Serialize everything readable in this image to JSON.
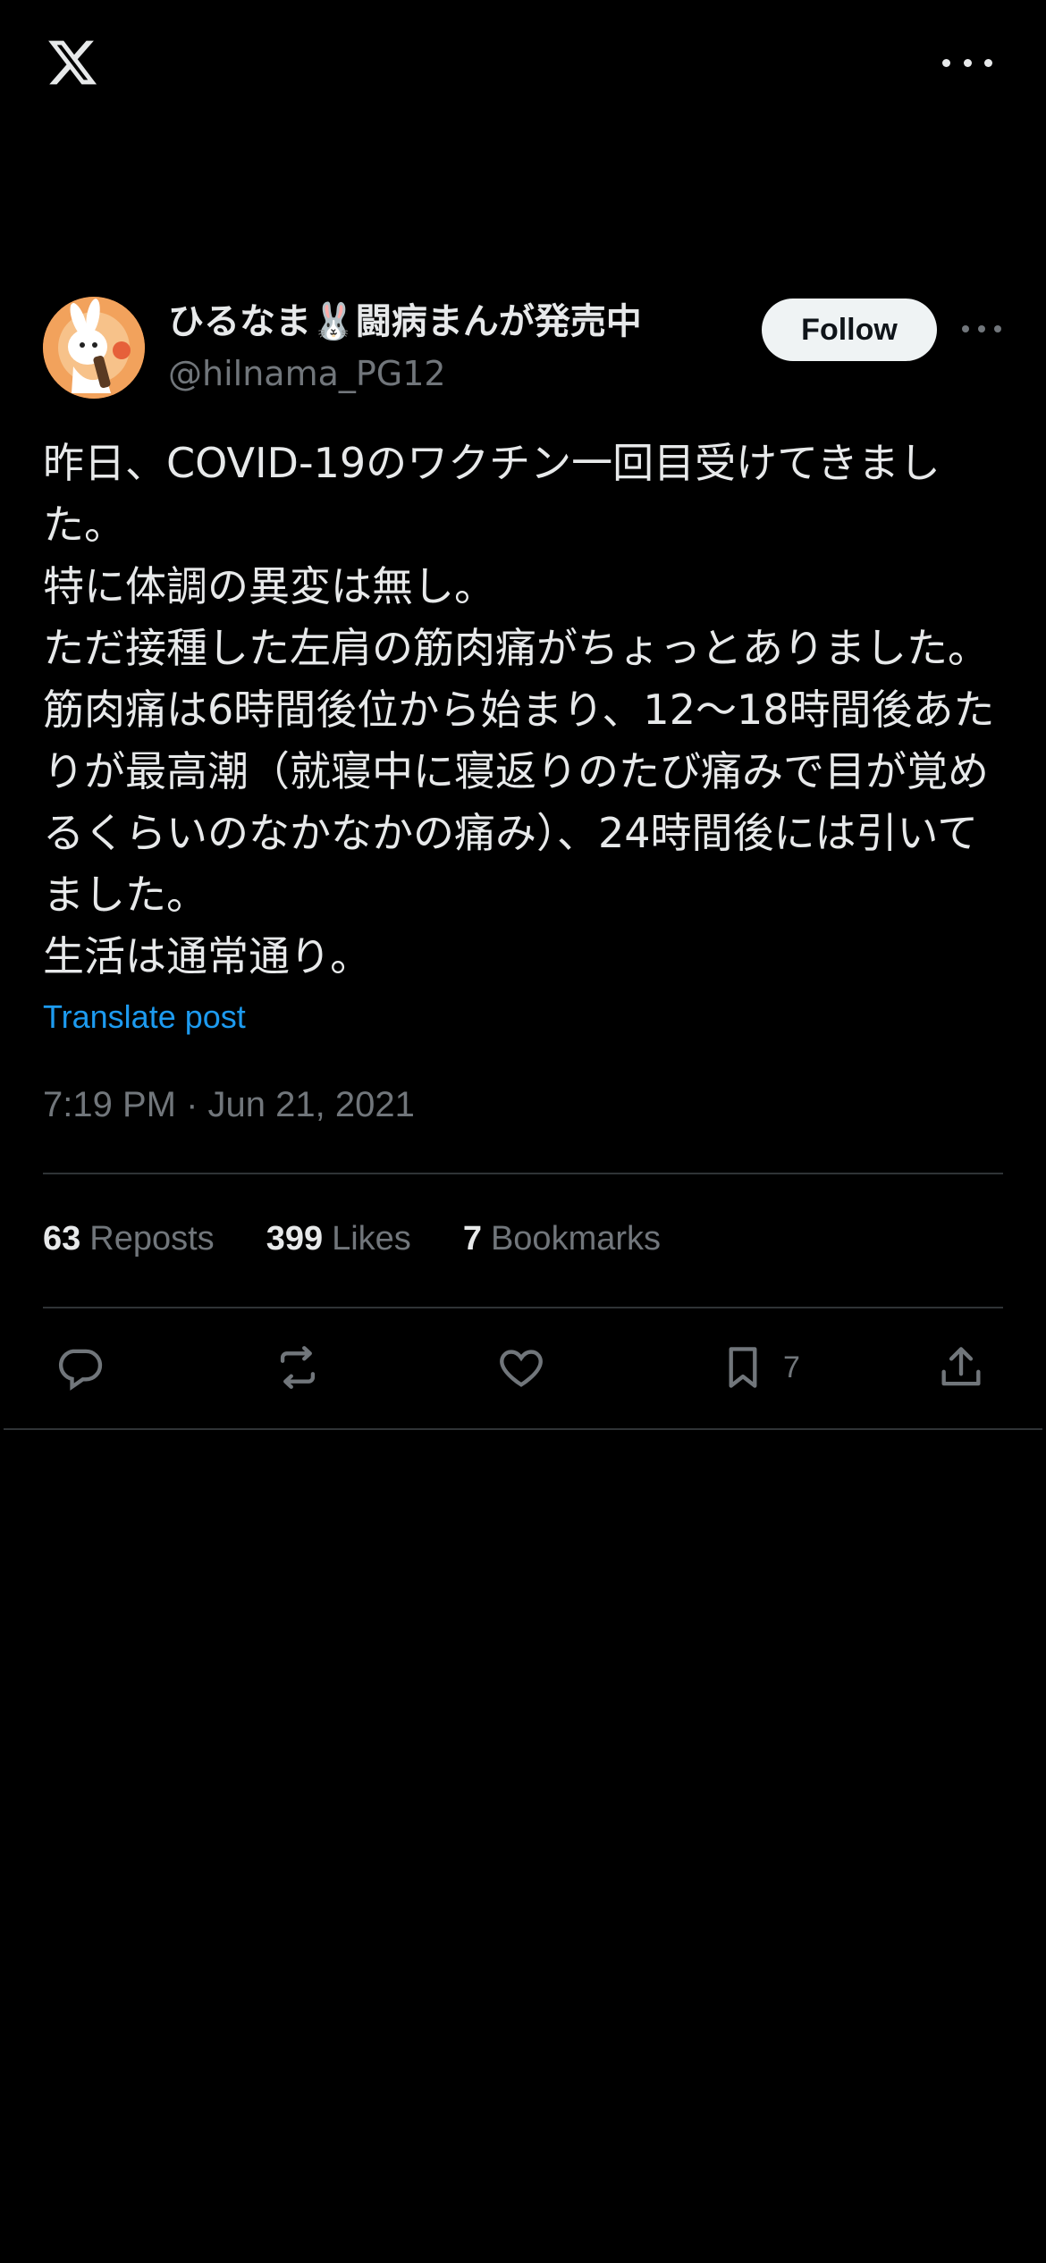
{
  "header": {
    "logo": "x-logo",
    "more_icon": "more-horizontal-icon"
  },
  "author": {
    "display_name": "ひるなま🐰闘病まんが発売中",
    "handle": "@hilnama_PG12",
    "avatar": "rabbit-avatar",
    "follow_label": "Follow"
  },
  "post": {
    "lines": [
      "昨日、COVID-19のワクチン一回目受けてきました。",
      "特に体調の異変は無し。",
      "ただ接種した左肩の筋肉痛がちょっとありました。筋肉痛は6時間後位から始まり、12〜18時間後あたりが最高潮（就寝中に寝返りのたび痛みで目が覚めるくらいのなかなかの痛み）、24時間後には引いてました。",
      "生活は通常通り。"
    ],
    "translate_label": "Translate post",
    "timestamp": "7:19 PM · Jun 21, 2021"
  },
  "stats": {
    "reposts_count": "63",
    "reposts_label": "Reposts",
    "likes_count": "399",
    "likes_label": "Likes",
    "bookmarks_count": "7",
    "bookmarks_label": "Bookmarks"
  },
  "actions": {
    "reply_icon": "reply-icon",
    "repost_icon": "repost-icon",
    "like_icon": "heart-icon",
    "bookmark_icon": "bookmark-icon",
    "bookmark_count": "7",
    "share_icon": "share-icon"
  },
  "colors": {
    "background": "#000000",
    "text": "#e7e9ea",
    "secondary": "#71767b",
    "link": "#1d9bf0",
    "divider": "#2f3336"
  }
}
